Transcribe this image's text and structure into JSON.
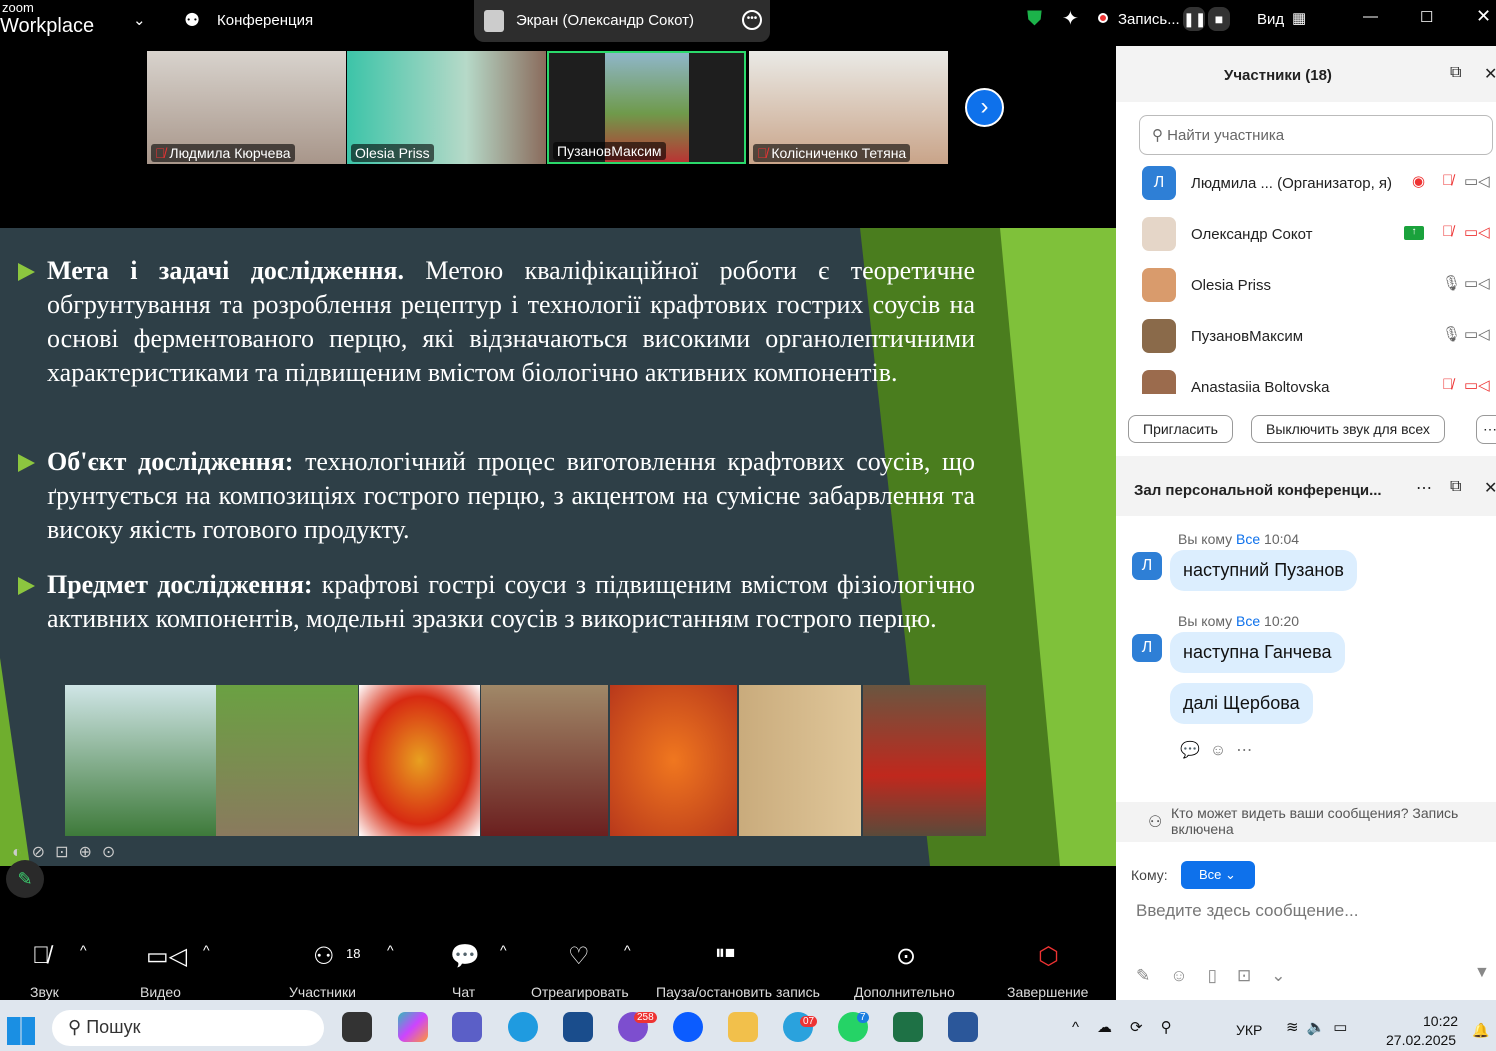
{
  "topbar": {
    "logo_small": "zoom",
    "logo_big": "Workplace",
    "meeting_label": "Конференция",
    "share_title": "Экран (Олександр Сокот)",
    "recording": "Запись...",
    "view": "Вид"
  },
  "thumbnails": [
    {
      "name": "Людмила Кюрчева",
      "muted": true
    },
    {
      "name": "Olesia Priss",
      "muted": false
    },
    {
      "name": "ПузановМаксим",
      "muted": false
    },
    {
      "name": "Колісниченко Тетяна",
      "muted": true
    }
  ],
  "slide": {
    "p1_bold": "Мета і задачі дослідження.",
    "p1": " Метою кваліфікаційної роботи є теоретичне обгрунтування та розроблення рецептур і технології крафтових гострих соусів на основі ферментованого перцю, які відзначаються високими органолептичними характеристиками та підвищеним вмістом біологічно активних компонентів.",
    "p2_bold": "Об'єкт дослідження:",
    "p2": " технологічний процес виготовлення крафтових соусів, що ґрунтується на композиціях гострого перцю, з акцентом на сумісне забарвлення та високу якість готового продукту.",
    "p3_bold": "Предмет дослідження:",
    "p3": " крафтові гострі соуси з підвищеним вмістом фізіологічно активних компонентів, модельні зразки соусів з використанням гострого перцю."
  },
  "participants": {
    "title": "Участники (18)",
    "search_placeholder": "Найти участника",
    "list": [
      {
        "name": "Людмила ...  (Организатор, я)",
        "initial": "Л"
      },
      {
        "name": "Олександр Сокот"
      },
      {
        "name": "Olesia Priss"
      },
      {
        "name": "ПузановМаксим"
      },
      {
        "name": "Anastasiia Boltovska"
      }
    ],
    "invite": "Пригласить",
    "mute_all": "Выключить звук для всех"
  },
  "chat": {
    "title": "Зал персональной конференци...",
    "messages": [
      {
        "meta": "Вы кому ",
        "to": "Все",
        "time": " 10:04",
        "texts": [
          "наступний Пузанов"
        ]
      },
      {
        "meta": "Вы кому ",
        "to": "Все",
        "time": " 10:20",
        "texts": [
          "наступна Ганчева",
          "далі Щербова"
        ]
      }
    ],
    "notice": "Кто может видеть ваши сообщения? Запись включена",
    "to_label": "Кому:",
    "to_value": "Все",
    "input_placeholder": "Введите здесь сообщение..."
  },
  "toolbar": {
    "audio": "Звук",
    "video": "Видео",
    "participants": "Участники",
    "participants_count": "18",
    "chat": "Чат",
    "react": "Отреагировать",
    "record": "Пауза/остановить запись",
    "more": "Дополнительно",
    "end": "Завершение"
  },
  "taskbar": {
    "search": "Пошук",
    "viber_badge": "258",
    "telegram_badge": "07",
    "whatsapp_badge": "7",
    "lang": "УКР",
    "time": "10:22",
    "date": "27.02.2025"
  }
}
